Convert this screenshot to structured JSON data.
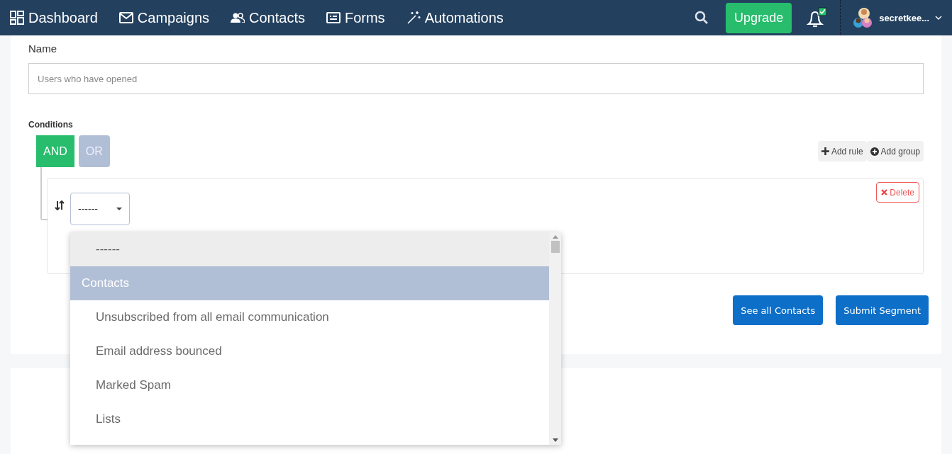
{
  "nav": {
    "items": [
      {
        "label": "Dashboard"
      },
      {
        "label": "Campaigns"
      },
      {
        "label": "Contacts"
      },
      {
        "label": "Forms"
      },
      {
        "label": "Automations"
      }
    ],
    "upgrade": "Upgrade",
    "notification_checked": true,
    "user": "secretkee..."
  },
  "name_field": {
    "label": "Name",
    "placeholder": "Users who have opened"
  },
  "conditions": {
    "label": "Conditions",
    "operators": [
      {
        "label": "AND",
        "selected": true
      },
      {
        "label": "OR",
        "selected": false
      }
    ],
    "add_rule": "Add rule",
    "add_group": "Add group",
    "delete": "Delete",
    "select_value": "------",
    "dropdown": [
      {
        "kind": "option",
        "label": "------",
        "selected": true
      },
      {
        "kind": "group",
        "label": "Contacts"
      },
      {
        "kind": "option",
        "label": "Unsubscribed from all email communication",
        "selected": false
      },
      {
        "kind": "option",
        "label": "Email address bounced",
        "selected": false
      },
      {
        "kind": "option",
        "label": "Marked Spam",
        "selected": false
      },
      {
        "kind": "option",
        "label": "Lists",
        "selected": false
      }
    ]
  },
  "buttons": [
    {
      "label": "See all Contacts"
    },
    {
      "label": "Submit Segment"
    }
  ]
}
